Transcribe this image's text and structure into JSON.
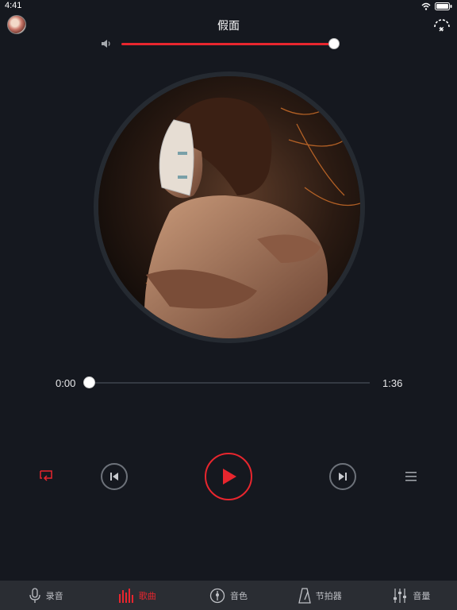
{
  "status_bar": {
    "time": "4:41"
  },
  "header": {
    "song_title": "假面"
  },
  "volume": {
    "level": 1.0
  },
  "playback": {
    "current_time": "0:00",
    "total_time": "1:36",
    "progress": 0.0
  },
  "tabs": [
    {
      "label": "录音",
      "icon": "microphone-icon",
      "active": false
    },
    {
      "label": "歌曲",
      "icon": "equalizer-bars-icon",
      "active": true
    },
    {
      "label": "音色",
      "icon": "guitar-pick-icon",
      "active": false
    },
    {
      "label": "节拍器",
      "icon": "metronome-icon",
      "active": false
    },
    {
      "label": "音量",
      "icon": "sliders-icon",
      "active": false
    }
  ],
  "colors": {
    "accent": "#e8262e",
    "background": "#15181f",
    "tab_bar": "#2a2d33"
  }
}
